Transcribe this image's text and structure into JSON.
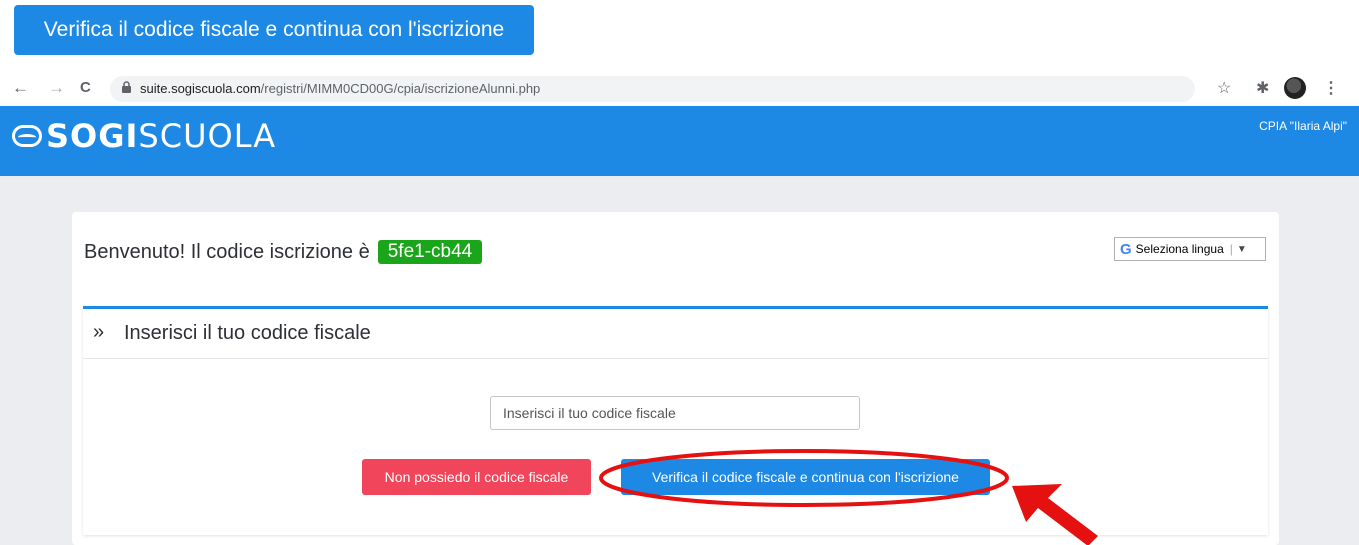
{
  "callout": {
    "label": "Verifica il codice fiscale e continua con l'iscrizione"
  },
  "browser": {
    "back_icon": "←",
    "forward_icon": "→",
    "reload_icon": "C",
    "url_host": "suite.sogiscuola.com",
    "url_path": "/registri/MIMM0CD00G/cpia/iscrizioneAlunni.php",
    "star_icon": "☆",
    "extensions_icon": "✱",
    "menu_icon": "⋮"
  },
  "header": {
    "logo_bold": "SOGI",
    "logo_light": "SCUOLA",
    "school": "CPIA \"Ilaria Alpi\"",
    "color": "#1e88e5"
  },
  "welcome": {
    "text": "Benvenuto! Il codice iscrizione è",
    "code": "5fe1-cb44",
    "code_color": "#1aa51a"
  },
  "language": {
    "g": "G",
    "label": "Seleziona lingua",
    "arrow": "▼"
  },
  "panel": {
    "icon": "»",
    "title": "Inserisci il tuo codice fiscale"
  },
  "form": {
    "cf_placeholder": "Inserisci il tuo codice fiscale",
    "no_cf_button": "Non possiedo il codice fiscale",
    "verify_button": "Verifica il codice fiscale e continua con l'iscrizione",
    "red_color": "#f0455a",
    "annotation_color": "#e51010"
  }
}
